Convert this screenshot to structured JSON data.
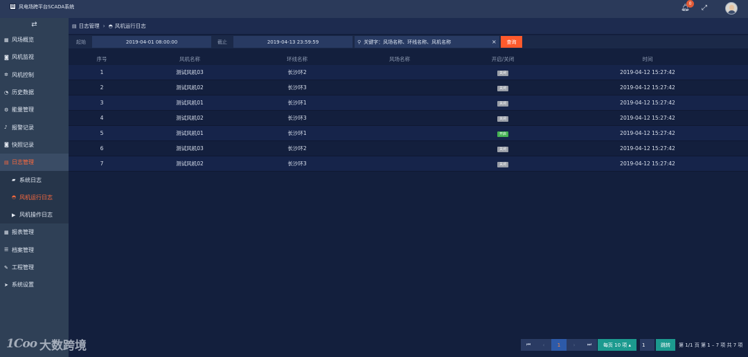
{
  "app": {
    "title": "风电场跨平台SCADA系统",
    "notification_count": "0"
  },
  "sidebar": {
    "toggle_icon": "swap-arrows-icon",
    "items": [
      {
        "label": "风场概览",
        "icon": "grid-icon"
      },
      {
        "label": "风机监视",
        "icon": "camera-icon"
      },
      {
        "label": "风机控制",
        "icon": "gear-icon"
      },
      {
        "label": "历史数据",
        "icon": "pie-icon"
      },
      {
        "label": "能量管理",
        "icon": "sliders-icon"
      },
      {
        "label": "报警记录",
        "icon": "bell-icon"
      },
      {
        "label": "快照记录",
        "icon": "camera-icon"
      },
      {
        "label": "日志管理",
        "icon": "doc-icon",
        "active": true
      },
      {
        "label": "系统日志",
        "icon": "book-icon",
        "sub": true
      },
      {
        "label": "风机运行日志",
        "icon": "gauge-icon",
        "sub": true,
        "active": true
      },
      {
        "label": "风机操作日志",
        "icon": "play-icon",
        "sub": true
      },
      {
        "label": "报表管理",
        "icon": "table-icon"
      },
      {
        "label": "档案管理",
        "icon": "list-icon"
      },
      {
        "label": "工程管理",
        "icon": "wrench-icon"
      },
      {
        "label": "系统设置",
        "icon": "send-icon"
      }
    ]
  },
  "breadcrumb": {
    "parent": "日志管理",
    "current": "风机运行日志"
  },
  "filter": {
    "start_label": "起始",
    "start_value": "2019-04-01 08:00:00",
    "end_label": "截止",
    "end_value": "2019-04-13 23:59:59",
    "keyword_placeholder": "关键字：风场名称、环线名称、风机名称",
    "clear": "×",
    "query_button": "查询"
  },
  "table": {
    "headers": [
      "序号",
      "风机名称",
      "环线名称",
      "风场名称",
      "开启/关闭",
      "时间"
    ],
    "rows": [
      {
        "seq": "1",
        "turbine": "测试风机03",
        "ring": "长沙环2",
        "field": "",
        "status": "关闭",
        "on": false,
        "time": "2019-04-12 15:27:42"
      },
      {
        "seq": "2",
        "turbine": "测试风机02",
        "ring": "长沙环3",
        "field": "",
        "status": "关闭",
        "on": false,
        "time": "2019-04-12 15:27:42"
      },
      {
        "seq": "3",
        "turbine": "测试风机01",
        "ring": "长沙环1",
        "field": "",
        "status": "关闭",
        "on": false,
        "time": "2019-04-12 15:27:42"
      },
      {
        "seq": "4",
        "turbine": "测试风机02",
        "ring": "长沙环3",
        "field": "",
        "status": "关闭",
        "on": false,
        "time": "2019-04-12 15:27:42"
      },
      {
        "seq": "5",
        "turbine": "测试风机01",
        "ring": "长沙环1",
        "field": "",
        "status": "开启",
        "on": true,
        "time": "2019-04-12 15:27:42"
      },
      {
        "seq": "6",
        "turbine": "测试风机03",
        "ring": "长沙环2",
        "field": "",
        "status": "关闭",
        "on": false,
        "time": "2019-04-12 15:27:42"
      },
      {
        "seq": "7",
        "turbine": "测试风机02",
        "ring": "长沙环3",
        "field": "",
        "status": "关闭",
        "on": false,
        "time": "2019-04-12 15:27:42"
      }
    ]
  },
  "pagination": {
    "first": "⏮",
    "prev": "‹",
    "current_page": "1",
    "next": "›",
    "last": "⏭",
    "per_page": "每页 10 项 ▴",
    "goto_value": "1",
    "jump_button": "跳转",
    "info": "第 1/1 页  第 1 – 7 项  共 7 项"
  },
  "watermark": {
    "mark": "1Coo",
    "text": "大数跨境"
  },
  "colors": {
    "accent": "#ff5a2c",
    "teal": "#1c9a8f",
    "on": "#44b152",
    "off": "#9a9fa8"
  }
}
